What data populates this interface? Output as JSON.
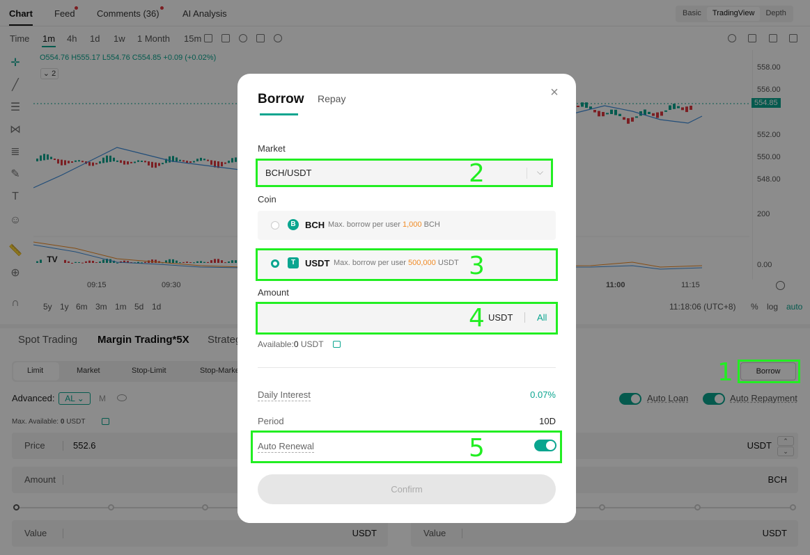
{
  "top_tabs": {
    "chart": "Chart",
    "feed": "Feed",
    "comments": "Comments (36)",
    "ai": "AI Analysis"
  },
  "view_switch": [
    "Basic",
    "TradingView",
    "Depth"
  ],
  "intervals": [
    "Time",
    "1m",
    "4h",
    "1d",
    "1w",
    "1 Month",
    "15m"
  ],
  "ohlc": {
    "o": "O554.76",
    "h": "H555.17",
    "l": "L554.76",
    "c": "C554.85",
    "chg": "+0.09 (+0.02%)"
  },
  "indicator_count": "2",
  "price_axis": [
    "558.00",
    "556.00",
    "554.85",
    "552.00",
    "550.00",
    "548.00",
    "200",
    "0.00"
  ],
  "time_axis": [
    "09:15",
    "09:30",
    "11:00",
    "11:15"
  ],
  "range_bar": {
    "ranges": [
      "5y",
      "1y",
      "6m",
      "3m",
      "1m",
      "5d",
      "1d"
    ],
    "clock": "11:18:06 (UTC+8)",
    "percent": "%",
    "log": "log",
    "auto": "auto"
  },
  "trade_tabs": [
    "Spot Trading",
    "Margin Trading*5X",
    "Strategy"
  ],
  "order_types": [
    "Limit",
    "Market",
    "Stop-Limit",
    "Stop-Market"
  ],
  "advanced": {
    "label": "Advanced:",
    "mode": "AL",
    "m": "M"
  },
  "max_available": {
    "label": "Max. Available:",
    "value": "0",
    "currency": "USDT"
  },
  "order_form": {
    "price_label": "Price",
    "price_value": "552.6",
    "price_currency": "USDT",
    "amount_label": "Amount",
    "amount_currency": "BCH",
    "value_label": "Value",
    "value_currency": "USDT",
    "value_label_right": "Value",
    "value_currency_right": "USDT"
  },
  "borrow_button": "Borrow",
  "toggles": {
    "auto_loan": "Auto Loan",
    "auto_repayment": "Auto Repayment"
  },
  "modal": {
    "tab_borrow": "Borrow",
    "tab_repay": "Repay",
    "close": "×",
    "market_label": "Market",
    "market_value": "BCH/USDT",
    "coin_label": "Coin",
    "coins": [
      {
        "symbol": "BCH",
        "max_label": "Max. borrow per user",
        "max_value": "1,000",
        "unit": "BCH",
        "icon": "B"
      },
      {
        "symbol": "USDT",
        "max_label": "Max. borrow per user",
        "max_value": "500,000",
        "unit": "USDT",
        "icon": "T"
      }
    ],
    "amount_label": "Amount",
    "amount_currency": "USDT",
    "amount_all": "All",
    "available_label": "Available:",
    "available_value": "0",
    "available_unit": "USDT",
    "daily_interest_label": "Daily Interest",
    "daily_interest_value": "0.07%",
    "period_label": "Period",
    "period_value": "10D",
    "auto_renewal_label": "Auto Renewal",
    "confirm": "Confirm"
  },
  "annotations": [
    "1",
    "2",
    "3",
    "4",
    "5"
  ],
  "colors": {
    "accent": "#0aa58f",
    "up": "#0aa58f",
    "down": "#e0383e",
    "highlight": "#f08a24",
    "annotation": "#22ee22"
  }
}
